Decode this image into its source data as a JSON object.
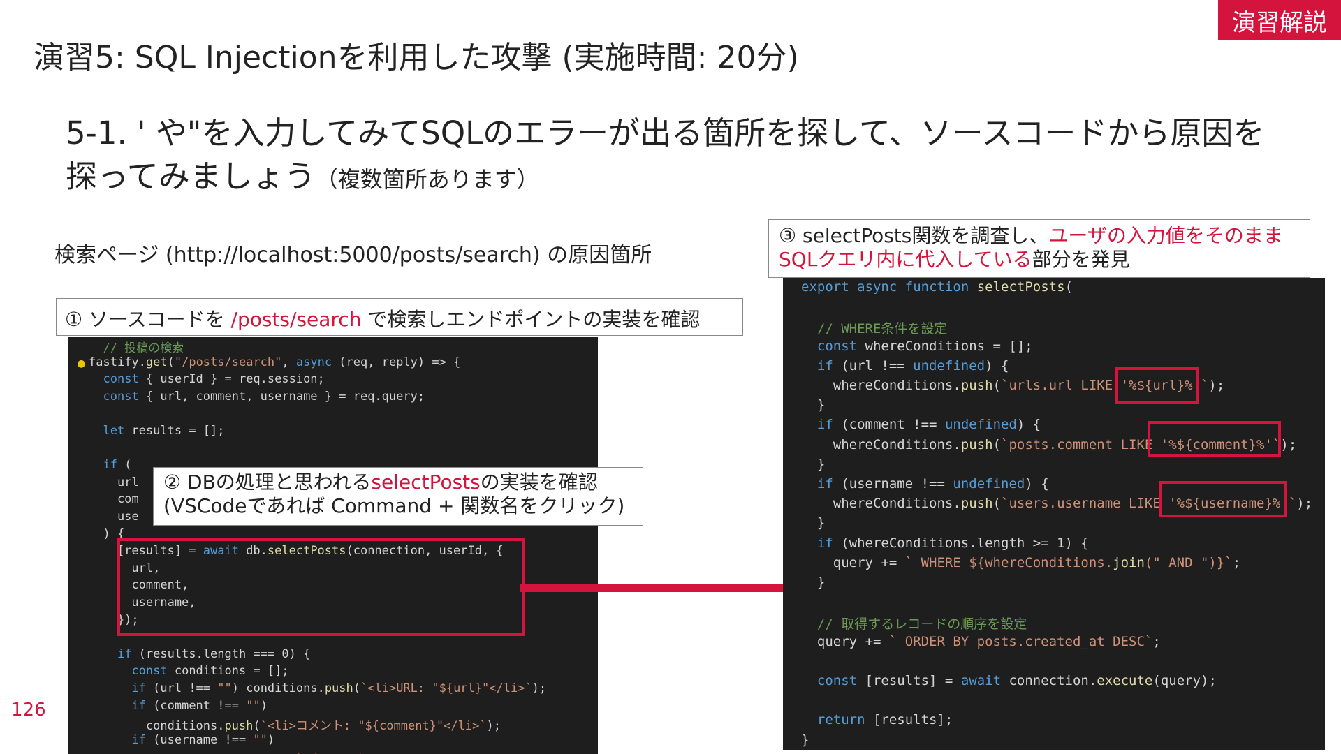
{
  "badge": "演習解説",
  "title": "演習5: SQL Injectionを利用した攻撃 (実施時間: 20分)",
  "task": {
    "main": "5-1. ' や\"を入力してみてSQLのエラーが出る箇所を探して、ソースコードから原因を探ってみましょう",
    "note": "（複数箇所あります）"
  },
  "search_label": "検索ページ (http://localhost:5000/posts/search) の原因箇所",
  "note1": {
    "prefix": "① ソースコードを ",
    "highlight": "/posts/search",
    "suffix": " で検索しエンドポイントの実装を確認"
  },
  "note2": {
    "line1_prefix": "② DBの処理と思われる",
    "line1_highlight": "selectPosts",
    "line1_suffix": "の実装を確認",
    "line2": "(VSCodeであれば Command + 関数名をクリック)"
  },
  "note3": {
    "prefix": "③ selectPosts関数を調査し、",
    "highlight": "ユーザの入力値をそのままSQLクエリ内に代入している",
    "suffix": "部分を発見"
  },
  "left_code": [
    "  // 投稿の検索",
    "fastify.get(\"/posts/search\", async (req, reply) => {",
    "  const { userId } = req.session;",
    "  const { url, comment, username } = req.query;",
    "",
    "  let results = [];",
    "",
    "  if (",
    "    url",
    "    com",
    "    use",
    "  ) {",
    "    [results] = await db.selectPosts(connection, userId, {",
    "      url,",
    "      comment,",
    "      username,",
    "    });",
    "",
    "    if (results.length === 0) {",
    "      const conditions = [];",
    "      if (url !== \"\") conditions.push(`<li>URL: \"${url}\"</li>`);",
    "      if (comment !== \"\")",
    "        conditions.push(`<li>コメント: \"${comment}\"</li>`);",
    "      if (username !== \"\")",
    "        conditions.push(`<li>投稿ユーザ名: \"${username}\"</li>`);"
  ],
  "right_code": [
    "export async function selectPosts(",
    "",
    "  // WHERE条件を設定",
    "  const whereConditions = [];",
    "  if (url !== undefined) {",
    "    whereConditions.push(`urls.url LIKE '%${url}%'`);",
    "  }",
    "  if (comment !== undefined) {",
    "    whereConditions.push(`posts.comment LIKE '%${comment}%'`);",
    "  }",
    "  if (username !== undefined) {",
    "    whereConditions.push(`users.username LIKE '%${username}%'`);",
    "  }",
    "  if (whereConditions.length >= 1) {",
    "    query += ` WHERE ${whereConditions.join(\" AND \")}`;",
    "  }",
    "",
    "  // 取得するレコードの順序を設定",
    "  query += ` ORDER BY posts.created_at DESC`;",
    "",
    "  const [results] = await connection.execute(query);",
    "",
    "  return [results];",
    "}"
  ],
  "page_number": "126",
  "colors": {
    "accent": "#d4143c",
    "code_bg": "#1e1e1e"
  }
}
